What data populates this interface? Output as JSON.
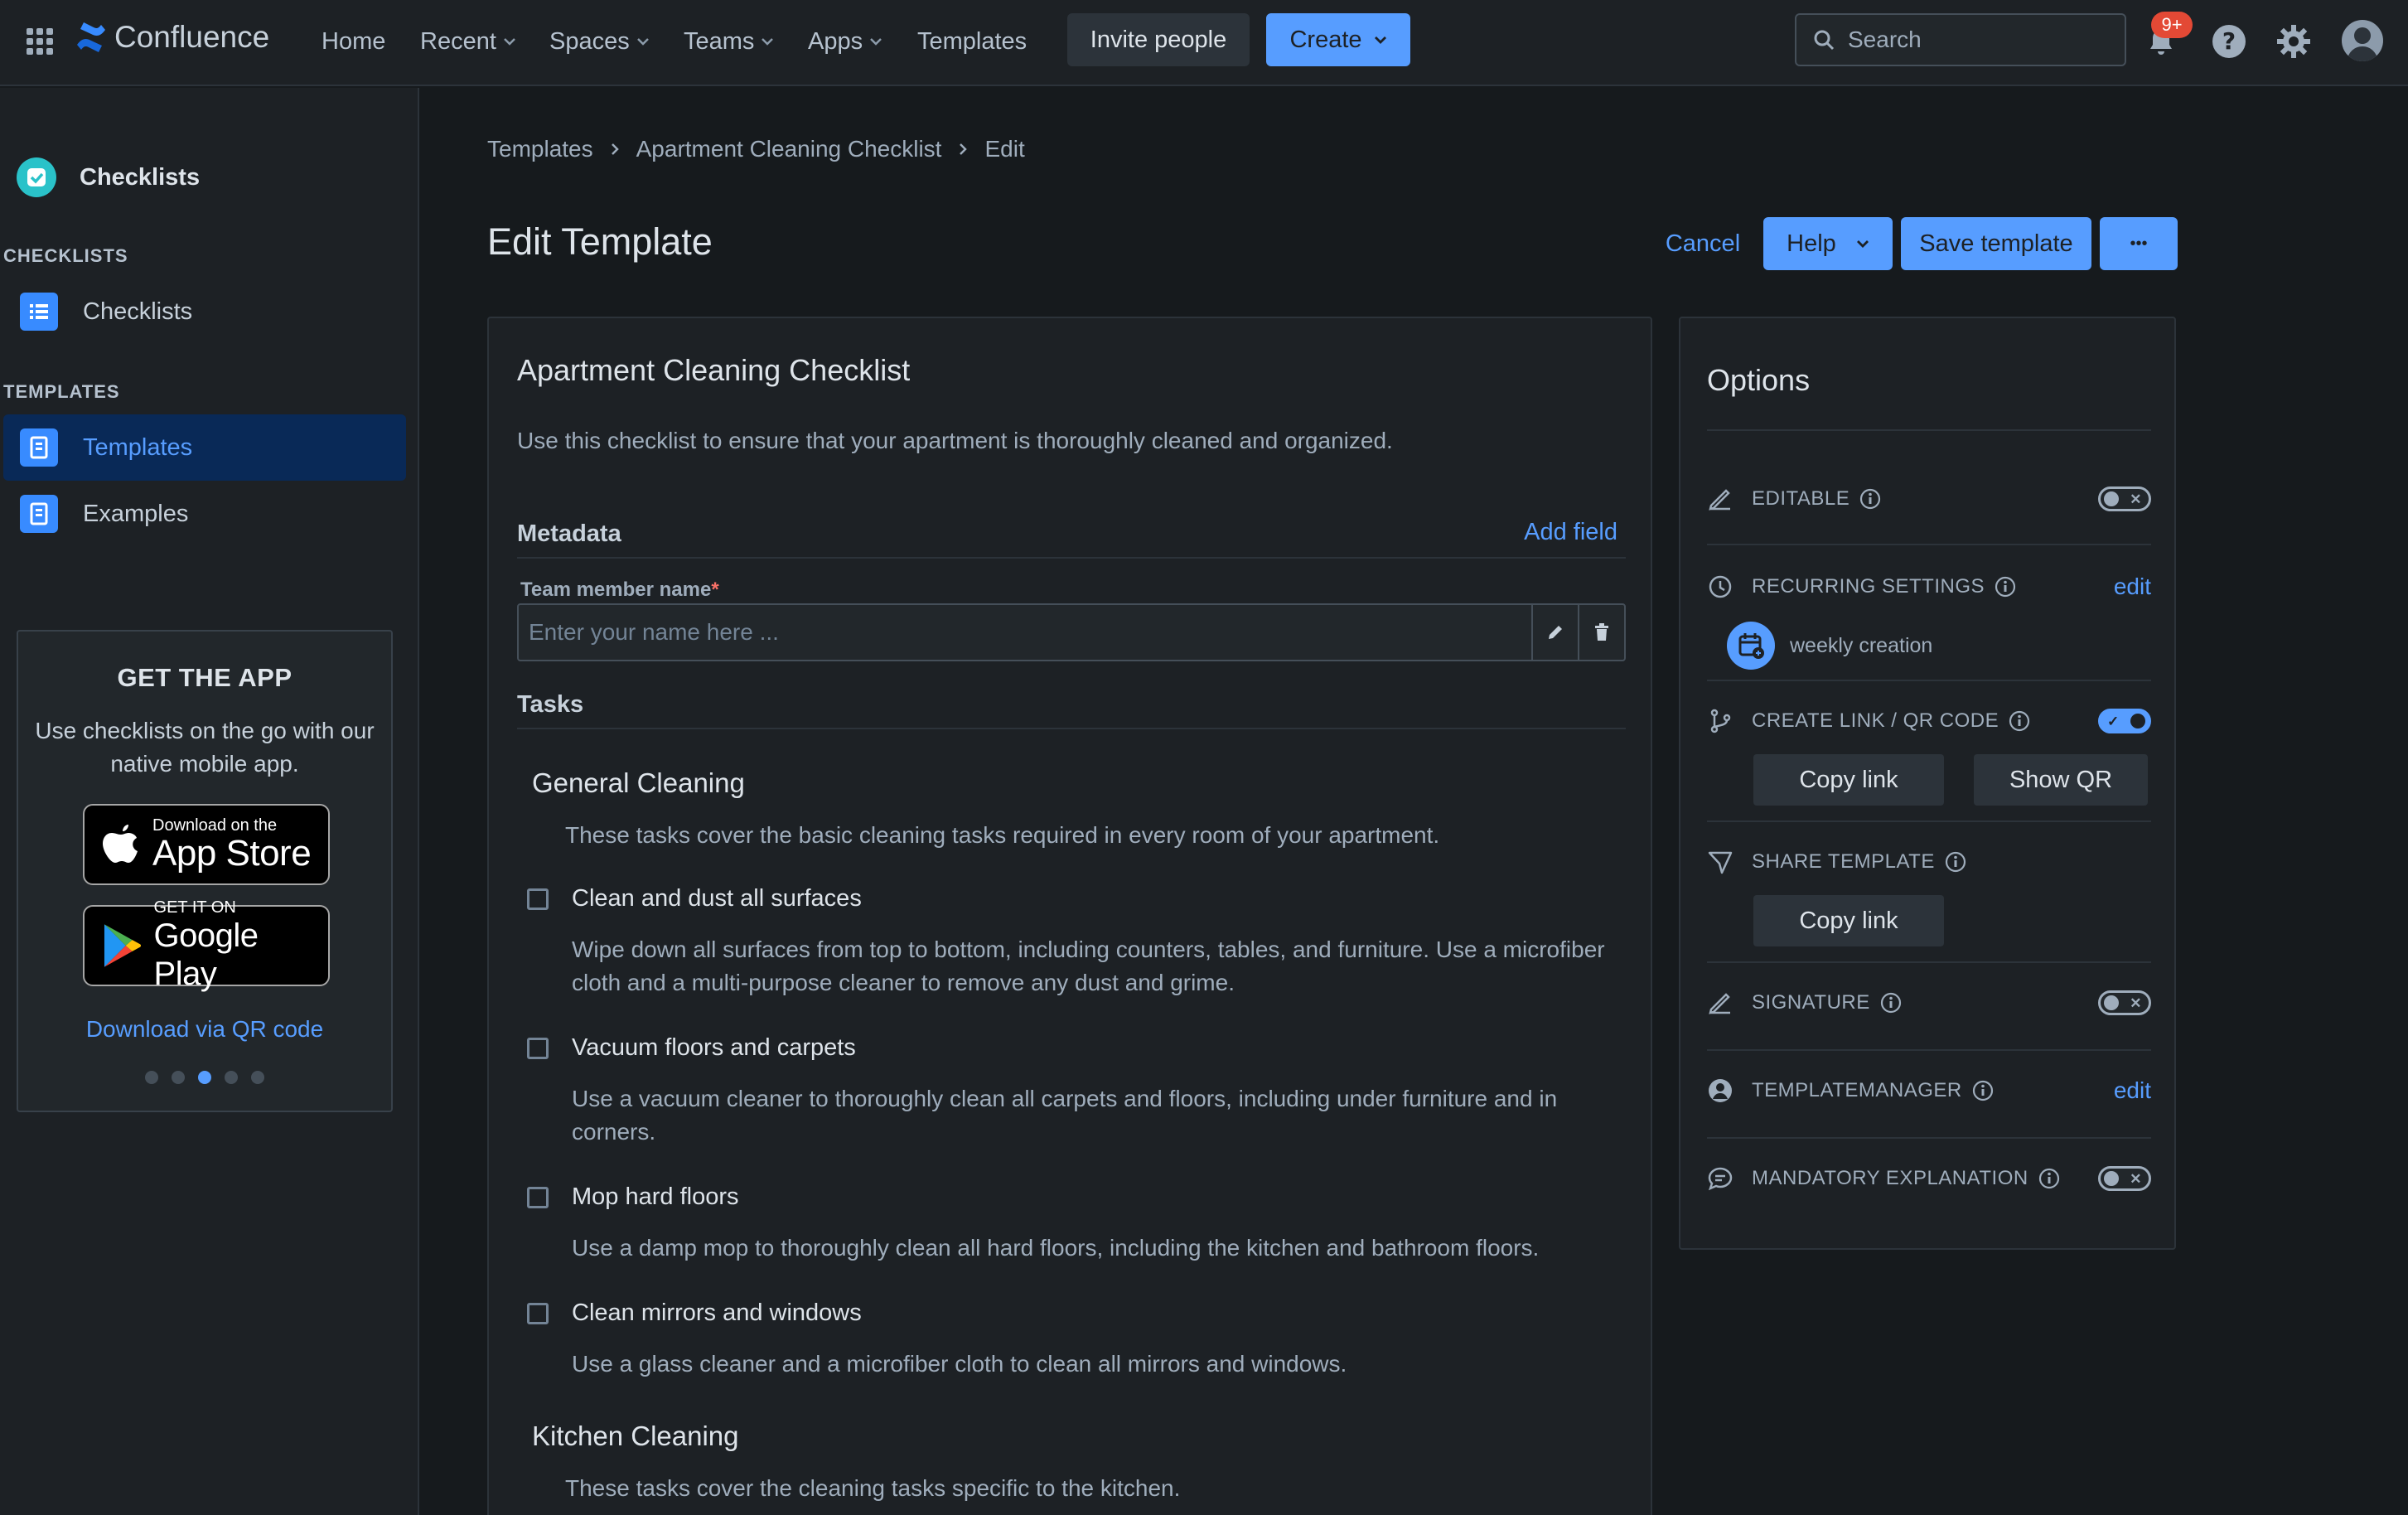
{
  "nav": {
    "brand": "Confluence",
    "items": [
      "Home",
      "Recent",
      "Spaces",
      "Teams",
      "Apps",
      "Templates"
    ],
    "invite": "Invite people",
    "create": "Create",
    "search_placeholder": "Search",
    "notification_count": "9+"
  },
  "sidebar": {
    "app_name": "Checklists",
    "cat_checklists": "CHECKLISTS",
    "item_checklists": "Checklists",
    "cat_templates": "TEMPLATES",
    "item_templates": "Templates",
    "item_examples": "Examples",
    "promo": {
      "title": "GET THE APP",
      "text": "Use checklists on the go with our native mobile app.",
      "appstore_small": "Download on the",
      "appstore_big": "App Store",
      "gplay_small": "GET IT ON",
      "gplay_big": "Google Play",
      "qr_link": "Download via QR code",
      "carousel_active": 3,
      "carousel_total": 5
    }
  },
  "breadcrumb": [
    "Templates",
    "Apartment Cleaning Checklist",
    "Edit"
  ],
  "page_title": "Edit Template",
  "actions": {
    "cancel": "Cancel",
    "help": "Help",
    "save": "Save template",
    "more": "•••"
  },
  "template": {
    "title": "Apartment Cleaning Checklist",
    "description": "Use this checklist to ensure that your apartment is thoroughly cleaned and organized.",
    "metadata_heading": "Metadata",
    "add_field": "Add field",
    "field_label": "Team member name",
    "field_required": "*",
    "field_placeholder": "Enter your name here ...",
    "tasks_heading": "Tasks",
    "groups": [
      {
        "title": "General Cleaning",
        "description": "These tasks cover the basic cleaning tasks required in every room of your apartment.",
        "tasks": [
          {
            "name": "Clean and dust all surfaces",
            "detail": "Wipe down all surfaces from top to bottom, including counters, tables, and furniture. Use a microfiber cloth and a multi-purpose cleaner to remove any dust and grime."
          },
          {
            "name": "Vacuum floors and carpets",
            "detail": "Use a vacuum cleaner to thoroughly clean all carpets and floors, including under furniture and in corners."
          },
          {
            "name": "Mop hard floors",
            "detail": "Use a damp mop to thoroughly clean all hard floors, including the kitchen and bathroom floors."
          },
          {
            "name": "Clean mirrors and windows",
            "detail": "Use a glass cleaner and a microfiber cloth to clean all mirrors and windows."
          }
        ]
      },
      {
        "title": "Kitchen Cleaning",
        "description": "These tasks cover the cleaning tasks specific to the kitchen."
      }
    ]
  },
  "options": {
    "title": "Options",
    "editable": {
      "label": "EDITABLE",
      "on": false
    },
    "recurring": {
      "label": "RECURRING SETTINGS",
      "edit": "edit",
      "value": "weekly creation"
    },
    "create_link": {
      "label": "CREATE LINK / QR CODE",
      "on": true,
      "copy": "Copy link",
      "show_qr": "Show QR"
    },
    "share": {
      "label": "SHARE TEMPLATE",
      "copy": "Copy link"
    },
    "signature": {
      "label": "SIGNATURE",
      "on": false
    },
    "manager": {
      "label": "TEMPLATEMANAGER",
      "edit": "edit"
    },
    "mandatory": {
      "label": "MANDATORY EXPLANATION",
      "on": false
    }
  },
  "colors": {
    "accent": "#579dff",
    "background": "#161a1d",
    "surface": "#1d2125",
    "badge": "#e34935"
  }
}
